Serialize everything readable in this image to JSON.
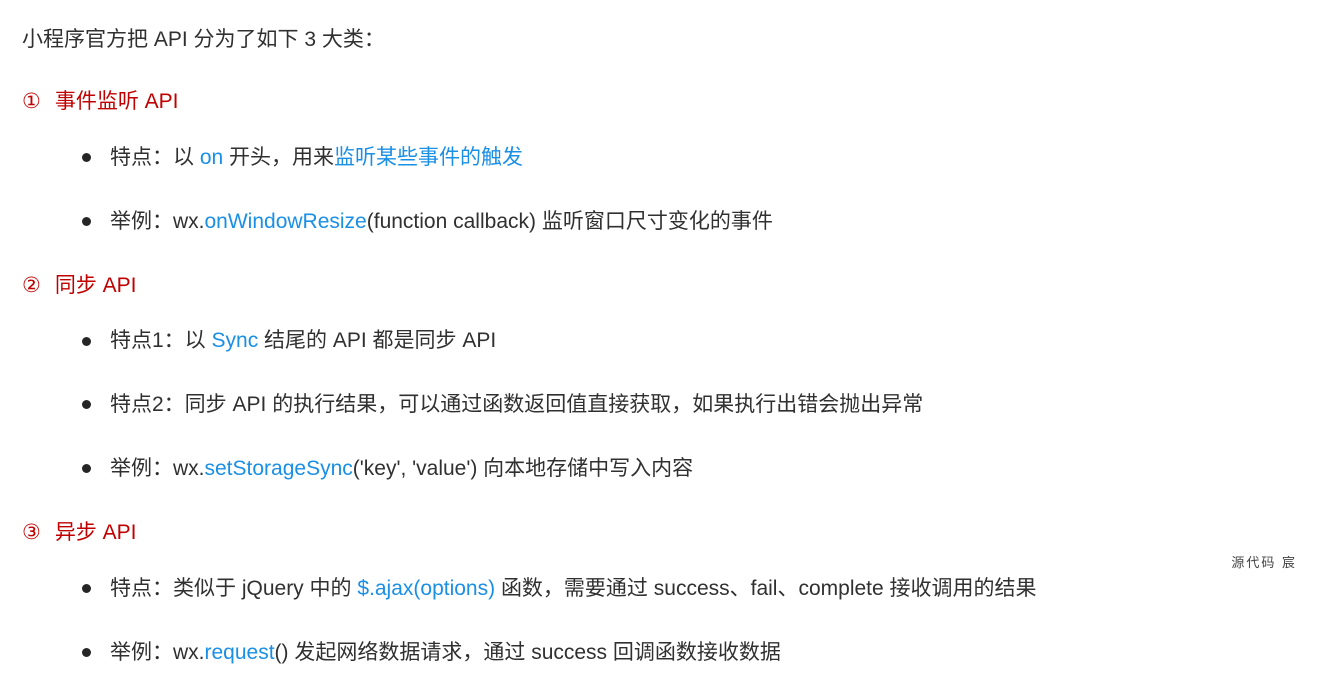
{
  "intro": "小程序官方把 API 分为了如下 3 大类：",
  "sections": [
    {
      "num": "①",
      "title": "事件监听 API",
      "bullets": [
        {
          "segments": [
            {
              "t": "特点：以 "
            },
            {
              "t": "on",
              "c": "blue"
            },
            {
              "t": " 开头，用来"
            },
            {
              "t": "监听某些事件的触发",
              "c": "blue"
            }
          ]
        },
        {
          "segments": [
            {
              "t": "举例：wx."
            },
            {
              "t": "onWindowResize",
              "c": "blue"
            },
            {
              "t": "(function callback) 监听窗口尺寸变化的事件"
            }
          ]
        }
      ]
    },
    {
      "num": "②",
      "title": "同步 API",
      "bullets": [
        {
          "segments": [
            {
              "t": "特点1：以 "
            },
            {
              "t": "Sync",
              "c": "blue"
            },
            {
              "t": " 结尾的 API 都是同步 API"
            }
          ]
        },
        {
          "segments": [
            {
              "t": "特点2：同步 API 的执行结果，可以通过函数返回值直接获取，如果执行出错会抛出异常"
            }
          ]
        },
        {
          "segments": [
            {
              "t": "举例：wx."
            },
            {
              "t": "setStorageSync",
              "c": "blue"
            },
            {
              "t": "('key', 'value') 向本地存储中写入内容"
            }
          ]
        }
      ]
    },
    {
      "num": "③",
      "title": "异步 API",
      "bullets": [
        {
          "segments": [
            {
              "t": "特点：类似于 jQuery 中的 "
            },
            {
              "t": "$.ajax(options) ",
              "c": "blue"
            },
            {
              "t": "函数，需要通过 success、fail、complete 接收调用的结果"
            }
          ]
        },
        {
          "segments": [
            {
              "t": "举例：wx."
            },
            {
              "t": "request",
              "c": "blue"
            },
            {
              "t": "() 发起网络数据请求，通过 success 回调函数接收数据"
            }
          ]
        }
      ]
    }
  ],
  "watermark": "源代码   宸"
}
